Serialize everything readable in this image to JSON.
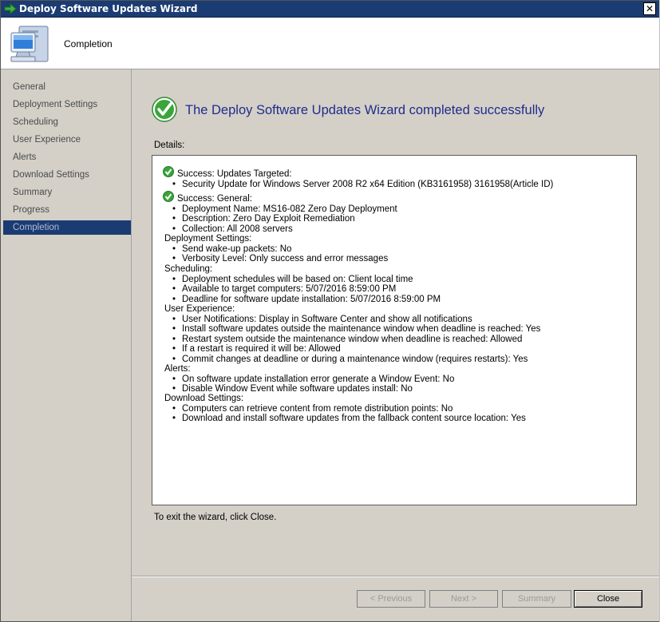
{
  "window": {
    "title": "Deploy Software Updates Wizard",
    "close_glyph": "✕",
    "accent_color": "#1b3c72"
  },
  "header": {
    "page_title": "Completion",
    "icon": "computer-icon"
  },
  "sidebar": {
    "items": [
      {
        "label": "General",
        "active": false
      },
      {
        "label": "Deployment Settings",
        "active": false
      },
      {
        "label": "Scheduling",
        "active": false
      },
      {
        "label": "User Experience",
        "active": false
      },
      {
        "label": "Alerts",
        "active": false
      },
      {
        "label": "Download Settings",
        "active": false
      },
      {
        "label": "Summary",
        "active": false
      },
      {
        "label": "Progress",
        "active": false
      },
      {
        "label": "Completion",
        "active": true
      }
    ]
  },
  "main": {
    "heading": "The Deploy Software Updates Wizard completed successfully",
    "details_label": "Details:",
    "exit_text": "To exit the wizard, click Close.",
    "details": {
      "success_targeted": "Success: Updates Targeted:",
      "security_update": "Security Update for Windows Server 2008 R2 x64 Edition (KB3161958) 3161958(Article ID)",
      "success_general": "Success: General:",
      "deployment_name": "Deployment Name: MS16-082 Zero Day Deployment",
      "description": "Description: Zero Day Exploit Remediation",
      "collection": "Collection: All 2008 servers",
      "deployment_settings_header": "Deployment Settings:",
      "wake_up": "Send wake-up packets: No",
      "verbosity": "Verbosity Level: Only success and error messages",
      "scheduling_header": "Scheduling:",
      "schedules_based": "Deployment schedules will be based on: Client local time",
      "available": "Available to target computers: 5/07/2016 8:59:00 PM",
      "deadline": "Deadline for software update installation: 5/07/2016 8:59:00 PM",
      "user_experience_header": "User Experience:",
      "notifications": "User Notifications: Display in Software Center and show all notifications",
      "install_outside": "Install software updates outside the maintenance window when deadline is reached: Yes",
      "restart_outside": "Restart system outside the maintenance window when deadline is reached: Allowed",
      "restart_required": "If a restart is required it will be: Allowed",
      "commit_changes": "Commit changes at deadline or during a maintenance window (requires restarts): Yes",
      "alerts_header": "Alerts:",
      "alert_error_event": "On software update installation error generate a Window Event: No",
      "alert_disable_event": "Disable Window Event while software updates install: No",
      "download_settings_header": "Download Settings:",
      "remote_dp": "Computers can retrieve content from remote distribution points: No",
      "fallback": "Download and install software updates from the fallback content source location: Yes"
    },
    "bullet": "•"
  },
  "buttons": {
    "previous": "< Previous",
    "next": "Next >",
    "summary": "Summary",
    "close": "Close"
  }
}
